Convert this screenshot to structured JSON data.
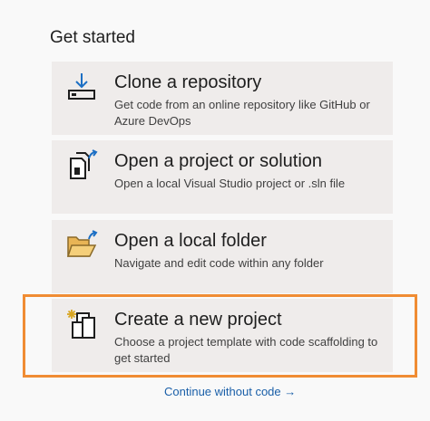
{
  "section_title": "Get started",
  "cards": [
    {
      "title": "Clone a repository",
      "description": "Get code from an online repository like GitHub or Azure DevOps",
      "icon": "clone-download-icon"
    },
    {
      "title": "Open a project or solution",
      "description": "Open a local Visual Studio project or .sln file",
      "icon": "open-project-icon"
    },
    {
      "title": "Open a local folder",
      "description": "Navigate and edit code within any folder",
      "icon": "open-folder-icon"
    },
    {
      "title": "Create a new project",
      "description": "Choose a project template with code scaffolding to get started",
      "icon": "new-project-icon"
    }
  ],
  "continue_link": "Continue without code →",
  "colors": {
    "card_background": "#efeceb",
    "highlight_border": "#f08c33",
    "link": "#1a5fa8",
    "icon_accent": "#1c6fc4"
  }
}
